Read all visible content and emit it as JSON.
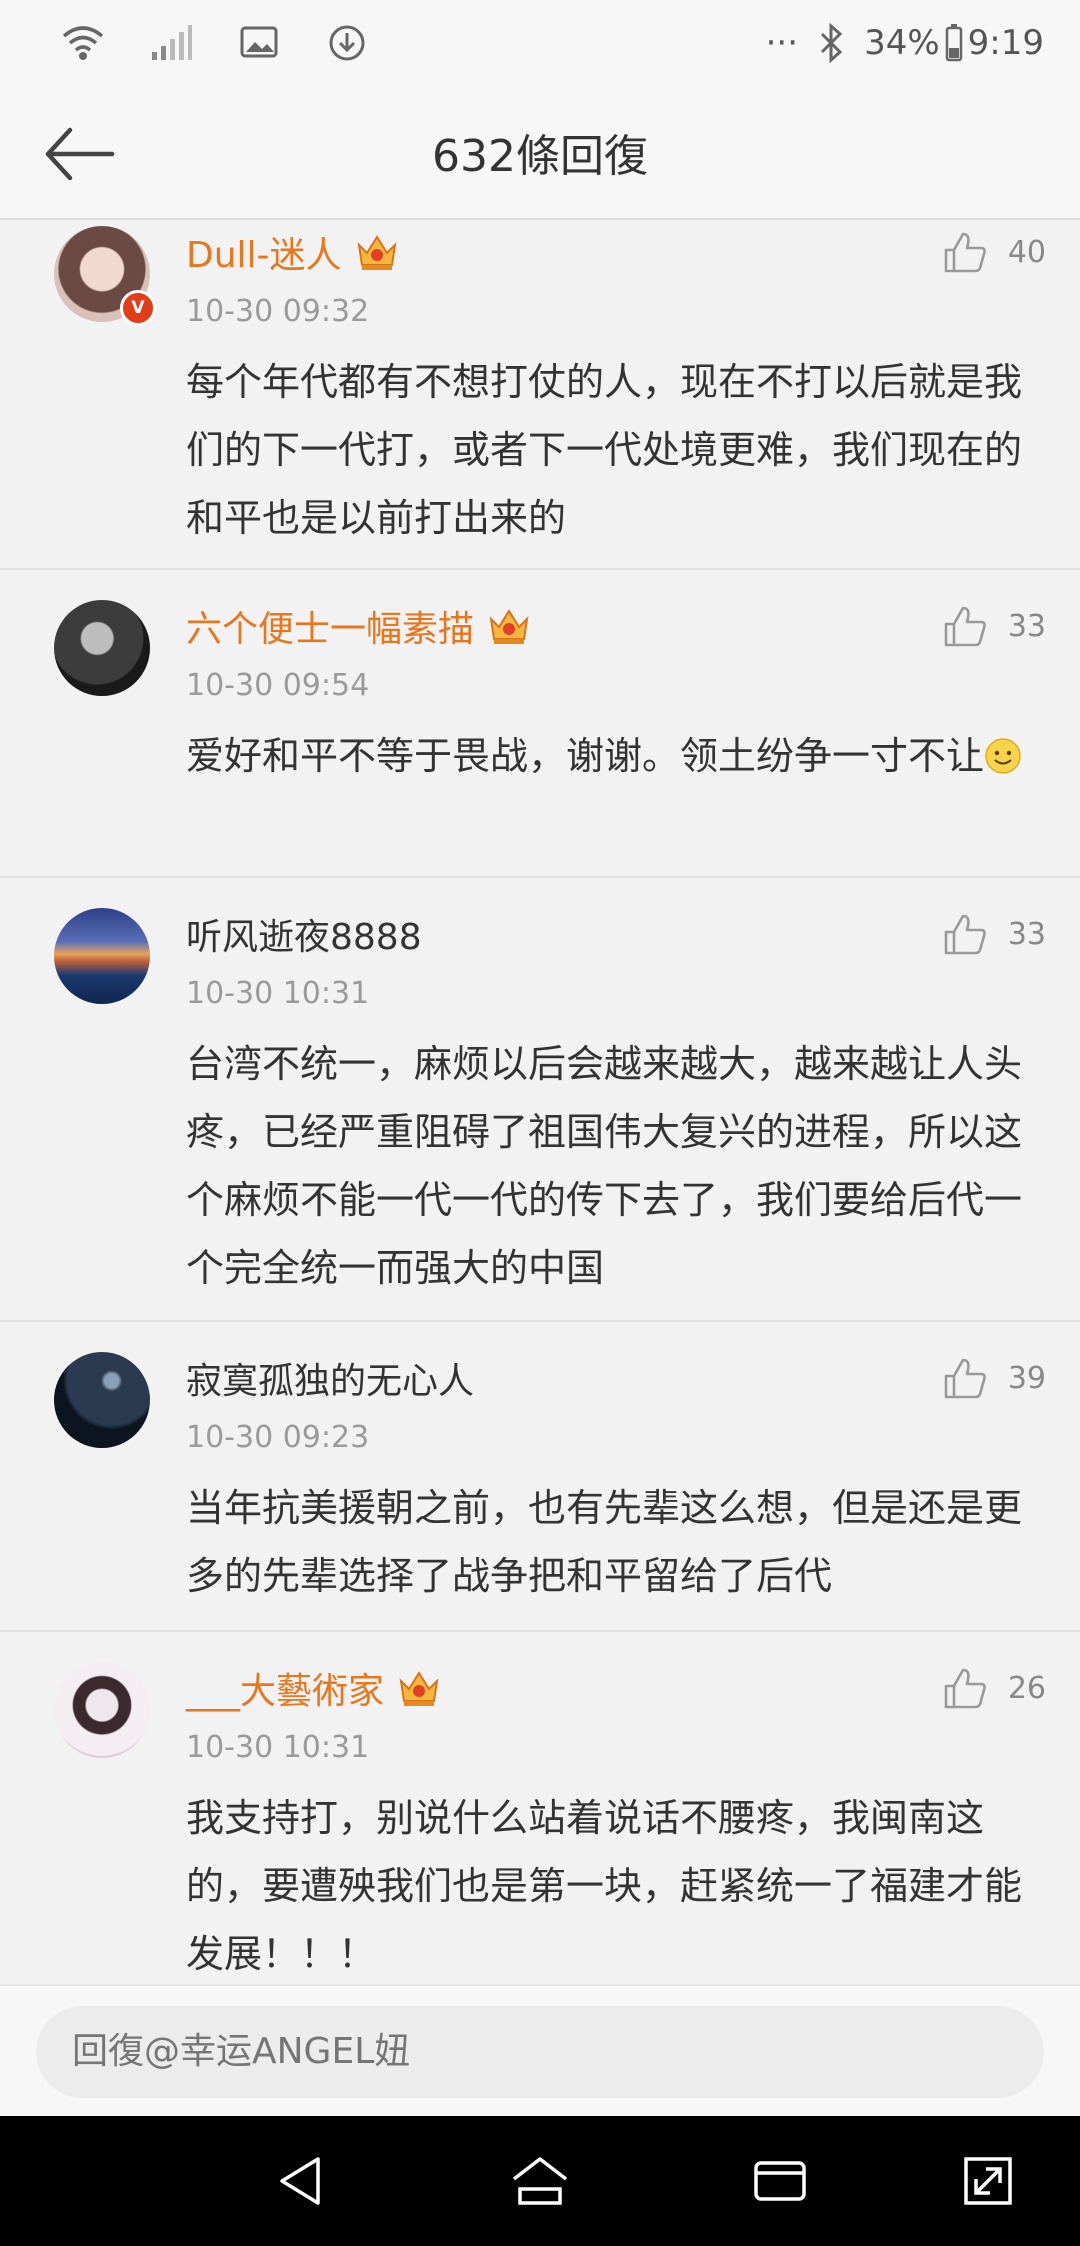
{
  "status_bar": {
    "battery": "34%",
    "time": "9:19",
    "more": "···"
  },
  "header": {
    "title": "632條回復"
  },
  "comments": [
    {
      "username": "Dull-迷人",
      "time": "10-30 09:32",
      "likes": "40",
      "text": "每个年代都有不想打仗的人，现在不打以后就是我们的下一代打，或者下一代处境更难，我们现在的和平也是以前打出来的"
    },
    {
      "username": "六个便士一幅素描",
      "time": "10-30 09:54",
      "likes": "33",
      "text": "爱好和平不等于畏战，谢谢。领土纷争一寸不让"
    },
    {
      "username": "听风逝夜8888",
      "time": "10-30 10:31",
      "likes": "33",
      "text": "台湾不统一，麻烦以后会越来越大，越来越让人头疼，已经严重阻碍了祖国伟大复兴的进程，所以这个麻烦不能一代一代的传下去了，我们要给后代一个完全统一而强大的中国"
    },
    {
      "username": "寂寞孤独的无心人",
      "time": "10-30 09:23",
      "likes": "39",
      "text": "当年抗美援朝之前，也有先辈这么想，但是还是更多的先辈选择了战争把和平留给了后代"
    },
    {
      "username": "___大藝術家",
      "time": "10-30 10:31",
      "likes": "26",
      "text": "我支持打，别说什么站着说话不腰疼，我闽南这的，要遭殃我们也是第一块，赶紧统一了福建才能发展！！！"
    }
  ],
  "reply": {
    "placeholder": "回復@幸运ANGEL妞"
  },
  "badges": {
    "verified": "V"
  },
  "colors": {
    "vip_name": "#e8761c",
    "verified_badge": "#e23c18"
  }
}
